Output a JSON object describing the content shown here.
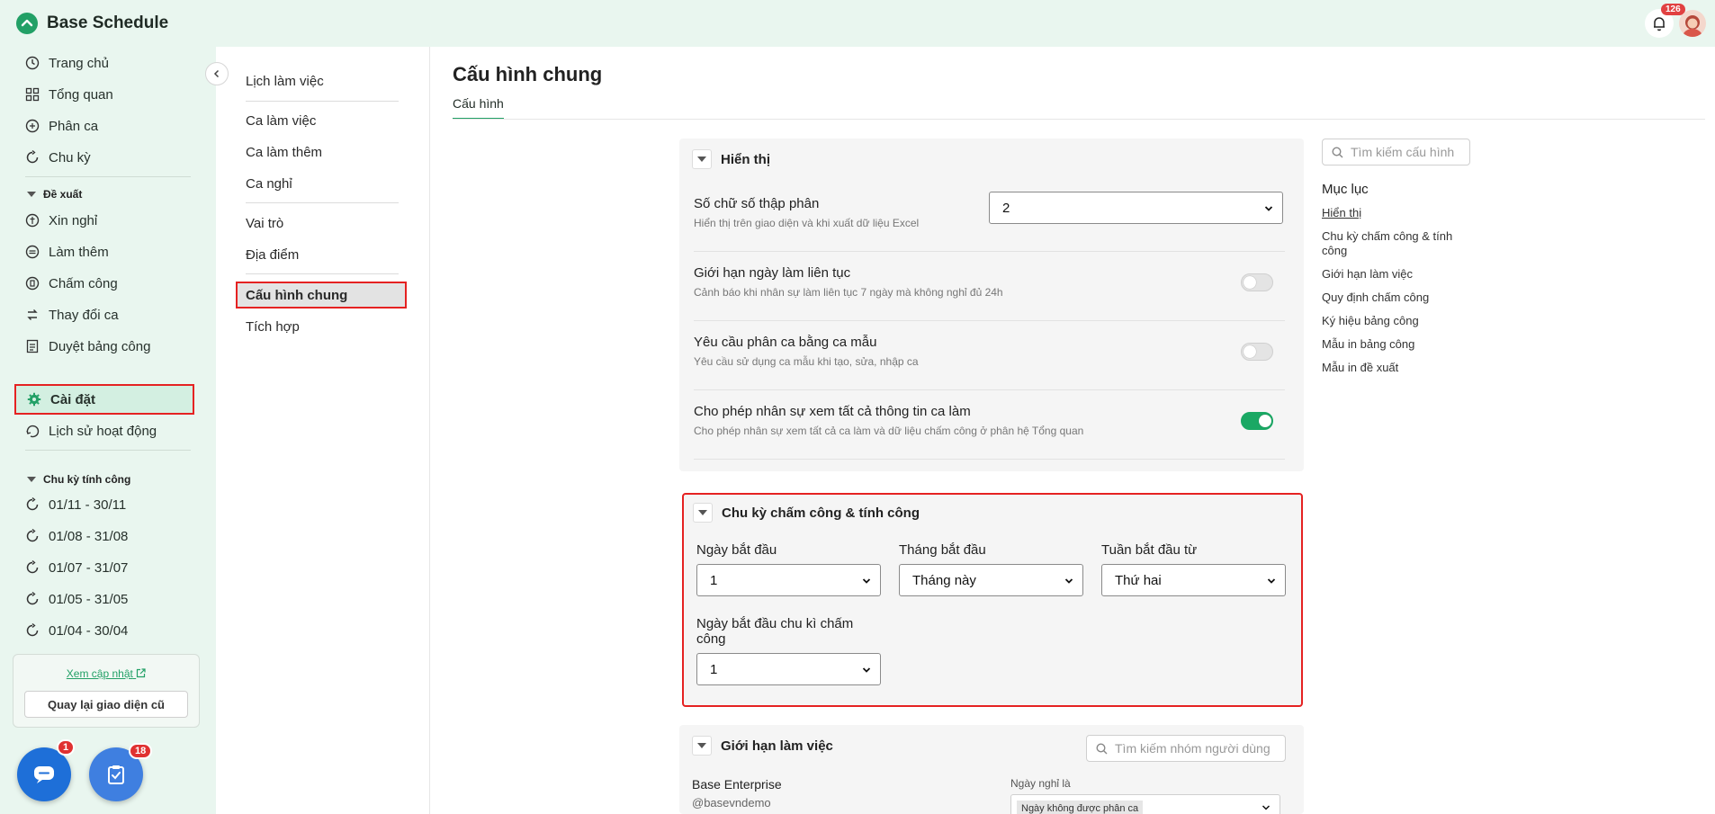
{
  "app": {
    "title": "Base Schedule",
    "notification_count": "126"
  },
  "sidebar": {
    "items": [
      {
        "label": "Trang chủ",
        "icon": "clock-icon"
      },
      {
        "label": "Tổng quan",
        "icon": "grid-icon"
      },
      {
        "label": "Phân ca",
        "icon": "shift-icon"
      },
      {
        "label": "Chu kỳ",
        "icon": "cycle-icon"
      }
    ],
    "proposal_section": "Đề xuất",
    "proposal_items": [
      {
        "label": "Xin nghỉ",
        "icon": "leave-icon"
      },
      {
        "label": "Làm thêm",
        "icon": "overtime-icon"
      },
      {
        "label": "Chấm công",
        "icon": "timesheet-icon"
      },
      {
        "label": "Thay đổi ca",
        "icon": "swap-icon"
      },
      {
        "label": "Duyệt bảng công",
        "icon": "approve-icon"
      }
    ],
    "settings_label": "Cài đặt",
    "history_label": "Lịch sử hoạt động",
    "cycle_section": "Chu kỳ tính công",
    "cycles": [
      "01/11 - 30/11",
      "01/08 - 31/08",
      "01/07 - 31/07",
      "01/05 - 31/05",
      "01/04 - 30/04"
    ],
    "update_link": "Xem cập nhật",
    "old_ui_button": "Quay lại giao diện cũ",
    "chat_badge": "1",
    "task_badge": "18"
  },
  "subnav": {
    "groups": [
      [
        "Lịch làm việc"
      ],
      [
        "Ca làm việc",
        "Ca làm thêm",
        "Ca nghỉ"
      ],
      [
        "Vai trò",
        "Địa điểm"
      ],
      [
        "Cấu hình chung",
        "Tích hợp"
      ]
    ]
  },
  "main": {
    "title": "Cấu hình chung",
    "tab": "Cấu hình",
    "display": {
      "heading": "Hiển thị",
      "decimal": {
        "title": "Số chữ số thập phân",
        "desc": "Hiển thị trên giao diện và khi xuất dữ liệu Excel",
        "value": "2"
      },
      "rows": [
        {
          "title": "Giới hạn ngày làm liên tục",
          "desc": "Cảnh báo khi nhân sự làm liên tục 7 ngày mà không nghỉ đủ 24h",
          "on": false
        },
        {
          "title": "Yêu cầu phân ca bằng ca mẫu",
          "desc": "Yêu cầu sử dụng ca mẫu khi tạo, sửa, nhập ca",
          "on": false
        },
        {
          "title": "Cho phép nhân sự xem tất cả thông tin ca làm",
          "desc": "Cho phép nhân sự xem tất cả ca làm và dữ liệu chấm công ở phân hệ Tổng quan",
          "on": true
        }
      ]
    },
    "cycle": {
      "heading": "Chu kỳ chấm công & tính công",
      "start_day_label": "Ngày bắt đầu",
      "start_day_value": "1",
      "start_month_label": "Tháng bắt đầu",
      "start_month_value": "Tháng này",
      "start_week_label": "Tuần bắt đầu từ",
      "start_week_value": "Thứ hai",
      "cycle_start_label": "Ngày bắt đầu chu kì chấm công",
      "cycle_start_value": "1"
    },
    "work_limit": {
      "heading": "Giới hạn làm việc",
      "search_placeholder": "Tìm kiếm nhóm người dùng",
      "org_name": "Base Enterprise",
      "org_handle": "@basevndemo",
      "day_off_label": "Ngày nghỉ là",
      "day_off_tag": "Ngày không được phân ca"
    }
  },
  "toc": {
    "search_placeholder": "Tìm kiếm cấu hình",
    "title": "Mục lục",
    "items": [
      "Hiển thị",
      "Chu kỳ chấm công & tính công",
      "Giới hạn làm việc",
      "Quy định chấm công",
      "Ký hiệu bảng công",
      "Mẫu in bảng công",
      "Mẫu in đề xuất"
    ]
  },
  "colors": {
    "brand": "#22a066",
    "sidebar_bg": "#e9f6ef",
    "highlight": "#e52222"
  }
}
